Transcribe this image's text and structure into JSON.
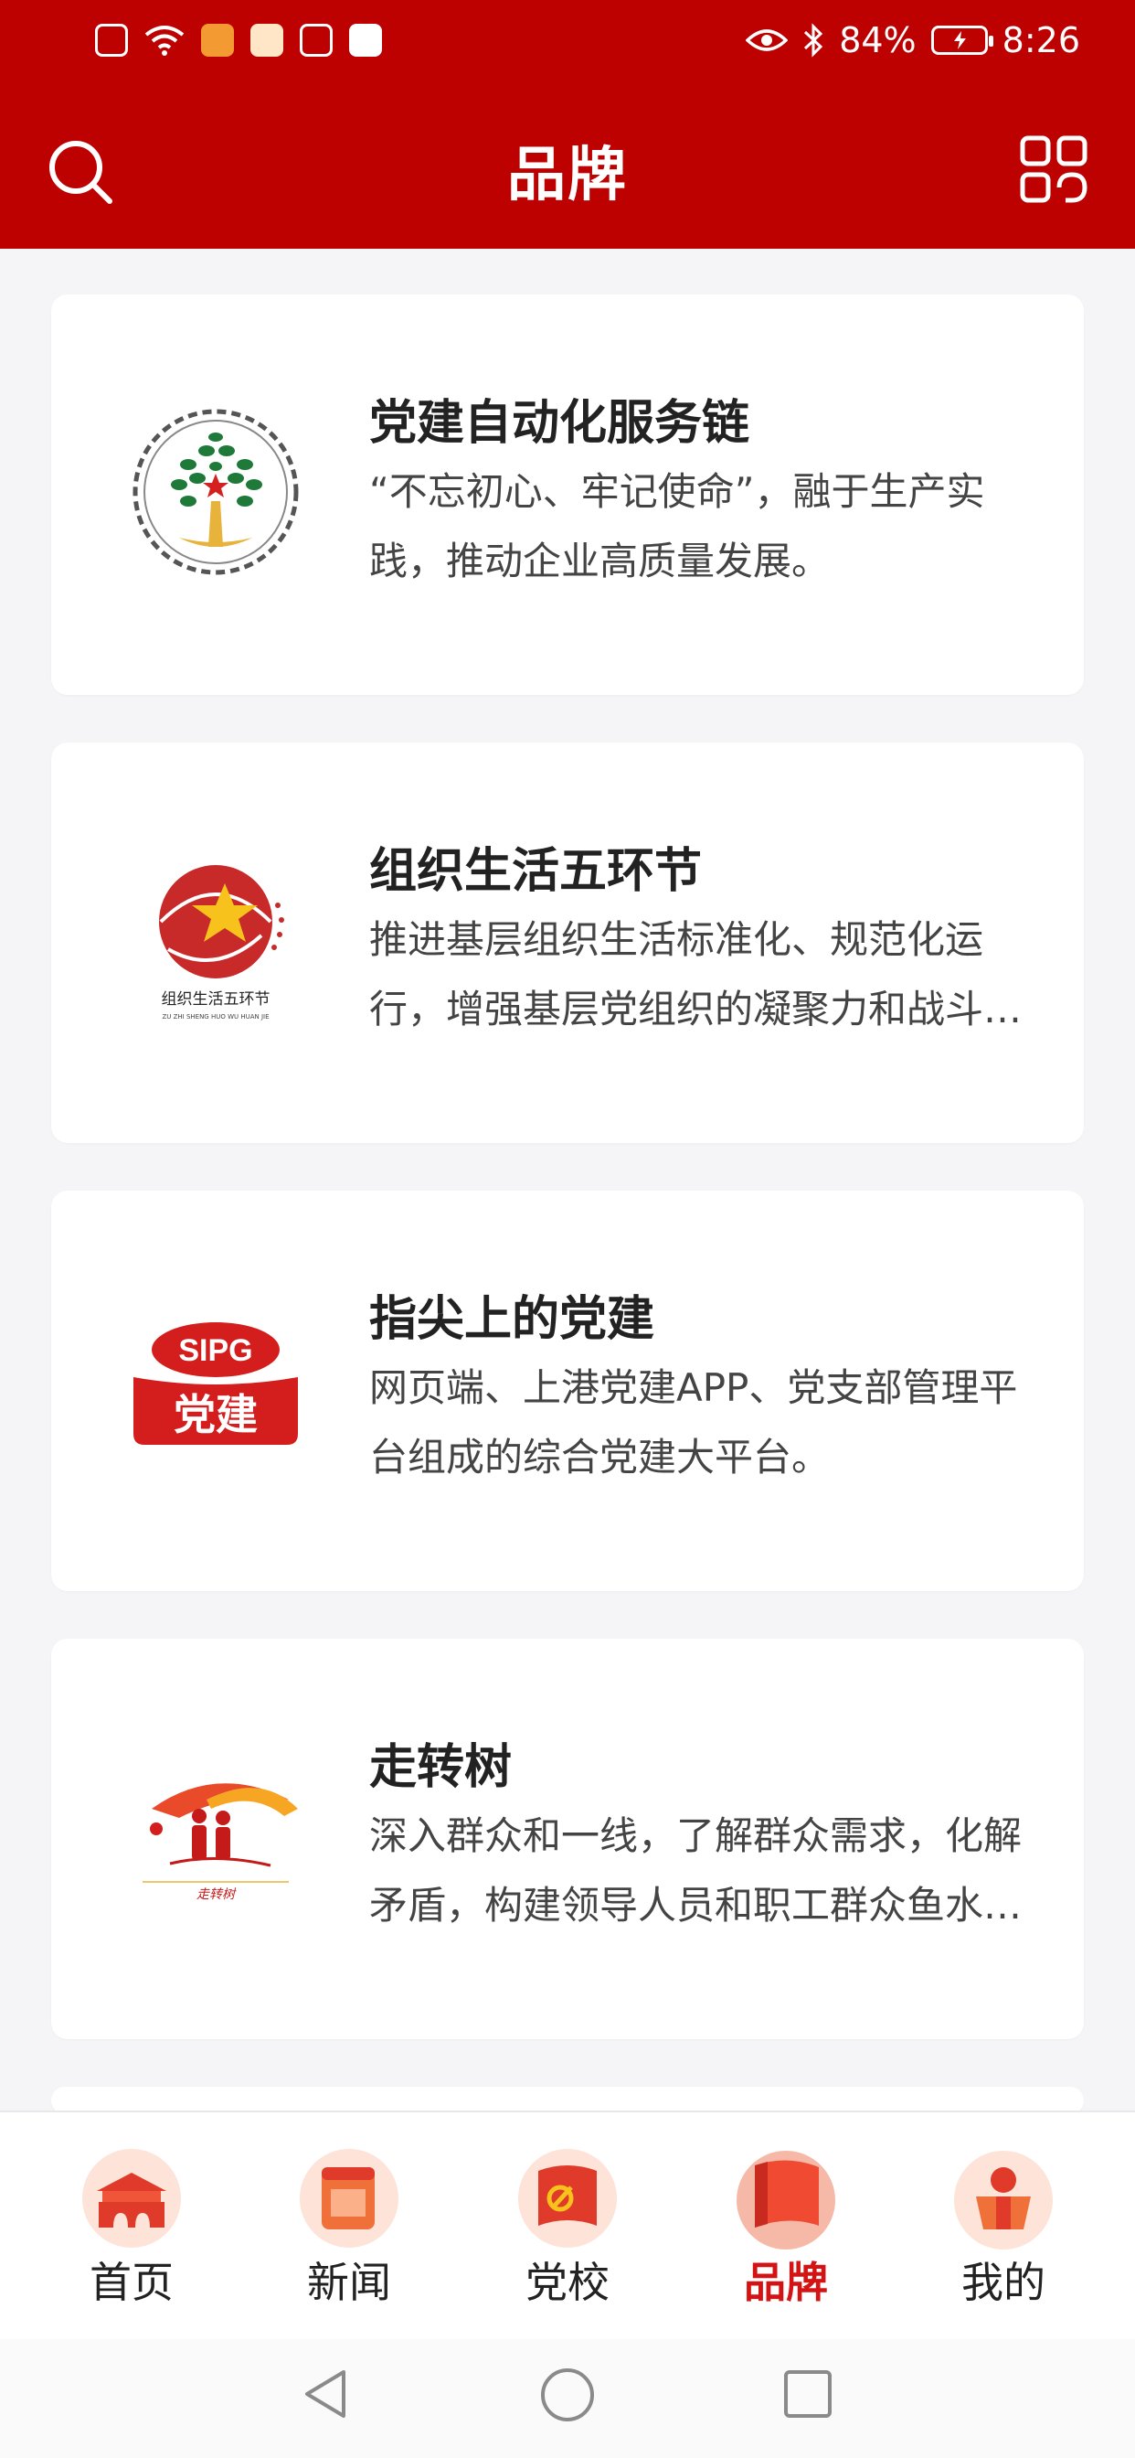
{
  "status_bar": {
    "battery": "84%",
    "time": "8:26"
  },
  "header": {
    "title": "品牌"
  },
  "cards": [
    {
      "title": "党建自动化服务链",
      "desc": "“不忘初心、牢记使命”，融于生产实践，推动企业高质量发展。",
      "logo": "tree-gear-logo"
    },
    {
      "title": "组织生活五环节",
      "desc": "推进基层组织生活标准化、规范化运行，增强基层党组织的凝聚力和战斗力。",
      "logo_text": "组织生活五环节",
      "logo_sub": "ZU ZHI SHENG HUO WU HUAN JIE"
    },
    {
      "title": "指尖上的党建",
      "desc": "网页端、上港党建APP、党支部管理平台组成的综合党建大平台。",
      "logo_top": "SIPG",
      "logo_bottom": "党建"
    },
    {
      "title": "走转树",
      "desc": "深入群众和一线，了解群众需求，化解矛盾，构建领导人员和职工群众鱼水关系。",
      "logo_text": "走转树"
    }
  ],
  "tabs": [
    {
      "label": "首页",
      "icon": "tiananmen-icon"
    },
    {
      "label": "新闻",
      "icon": "calendar-news-icon"
    },
    {
      "label": "党校",
      "icon": "party-flag-icon"
    },
    {
      "label": "品牌",
      "icon": "brand-flag-icon",
      "active": true
    },
    {
      "label": "我的",
      "icon": "profile-icon"
    }
  ],
  "colors": {
    "primary": "#bd0000",
    "active_tab": "#d41414"
  }
}
